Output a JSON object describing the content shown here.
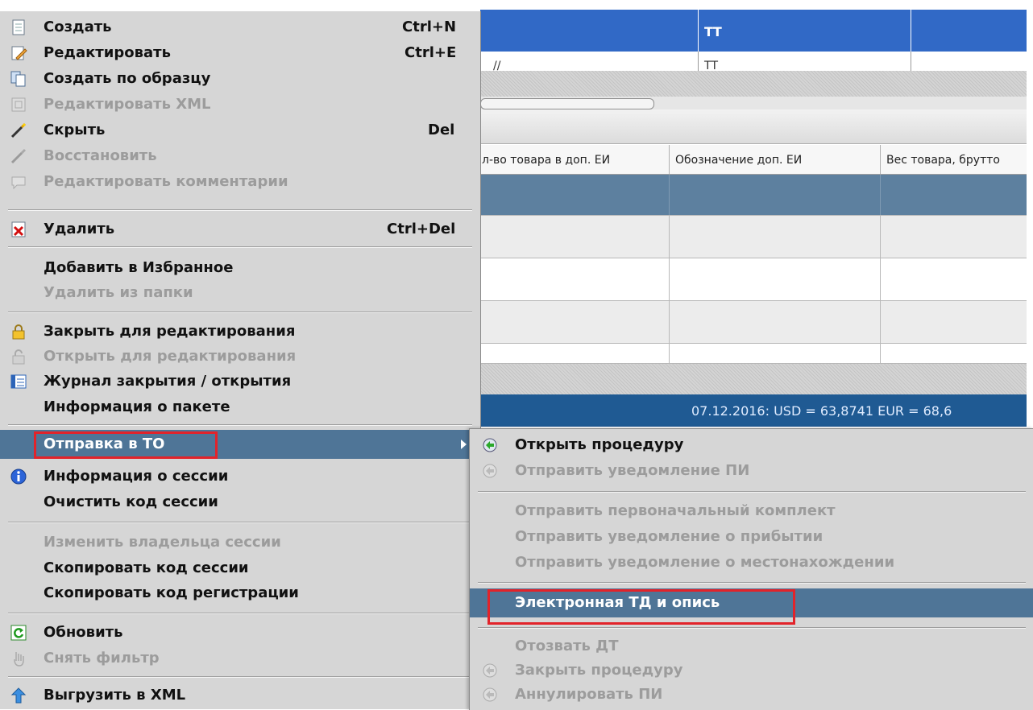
{
  "background": {
    "top_grid": {
      "header_col2": "ТТ",
      "row_col1": "//",
      "row_col2": "ТТ"
    },
    "grid_columns": [
      "л-во товара в доп. ЕИ",
      "Обозначение доп. ЕИ",
      "Вес товара, брутто"
    ],
    "status_bar": {
      "text": "07.12.2016:  USD = 63,8741  EUR = 68,6"
    }
  },
  "context_menu": {
    "items": [
      {
        "label": "Создать",
        "shortcut": "Ctrl+N",
        "icon": "document-new-icon",
        "enabled": true
      },
      {
        "label": "Редактировать",
        "shortcut": "Ctrl+E",
        "icon": "pencil-edit-icon",
        "enabled": true
      },
      {
        "label": "Создать по образцу",
        "shortcut": "",
        "icon": "copy-document-icon",
        "enabled": true
      },
      {
        "label": "Редактировать XML",
        "shortcut": "",
        "icon": "xml-edit-icon",
        "enabled": false
      },
      {
        "label": "Скрыть",
        "shortcut": "Del",
        "icon": "wand-hide-icon",
        "enabled": true
      },
      {
        "label": "Восстановить",
        "shortcut": "",
        "icon": "restore-icon",
        "enabled": false
      },
      {
        "label": "Редактировать комментарии",
        "shortcut": "",
        "icon": "comment-icon",
        "enabled": false
      },
      {
        "label": "Удалить",
        "shortcut": "Ctrl+Del",
        "icon": "delete-x-icon",
        "enabled": true
      },
      {
        "label": "Добавить в Избранное",
        "shortcut": "",
        "icon": "",
        "enabled": true
      },
      {
        "label": "Удалить из папки",
        "shortcut": "",
        "icon": "",
        "enabled": false
      },
      {
        "label": "Закрыть для редактирования",
        "shortcut": "",
        "icon": "lock-icon",
        "enabled": true
      },
      {
        "label": "Открыть для редактирования",
        "shortcut": "",
        "icon": "unlock-icon",
        "enabled": false
      },
      {
        "label": "Журнал закрытия / открытия",
        "shortcut": "",
        "icon": "list-log-icon",
        "enabled": true
      },
      {
        "label": "Информация о пакете",
        "shortcut": "",
        "icon": "",
        "enabled": true
      },
      {
        "label": "Отправка в ТО",
        "shortcut": "",
        "icon": "",
        "enabled": true
      },
      {
        "label": "Информация о сессии",
        "shortcut": "",
        "icon": "info-icon",
        "enabled": true
      },
      {
        "label": "Очистить код сессии",
        "shortcut": "",
        "icon": "",
        "enabled": true
      },
      {
        "label": "Изменить владельца сессии",
        "shortcut": "",
        "icon": "",
        "enabled": false
      },
      {
        "label": "Скопировать код сессии",
        "shortcut": "",
        "icon": "",
        "enabled": true
      },
      {
        "label": "Скопировать код регистрации",
        "shortcut": "",
        "icon": "",
        "enabled": true
      },
      {
        "label": "Обновить",
        "shortcut": "",
        "icon": "refresh-icon",
        "enabled": true
      },
      {
        "label": "Снять фильтр",
        "shortcut": "",
        "icon": "filter-clear-icon",
        "enabled": false
      },
      {
        "label": "Выгрузить в XML",
        "shortcut": "",
        "icon": "export-xml-icon",
        "enabled": true
      }
    ]
  },
  "submenu": {
    "items": [
      {
        "label": "Открыть процедуру",
        "icon": "procedure-open-icon",
        "enabled": true
      },
      {
        "label": "Отправить уведомление ПИ",
        "icon": "procedure-notify-icon",
        "enabled": false
      },
      {
        "label": "Отправить первоначальный комплект",
        "icon": "",
        "enabled": false
      },
      {
        "label": "Отправить уведомление о прибытии",
        "icon": "",
        "enabled": false
      },
      {
        "label": "Отправить уведомление о местонахождении",
        "icon": "",
        "enabled": false
      },
      {
        "label": "Электронная ТД и опись",
        "icon": "",
        "enabled": true
      },
      {
        "label": "Отозвать ДТ",
        "icon": "",
        "enabled": false
      },
      {
        "label": "Закрыть процедуру",
        "icon": "procedure-close-icon",
        "enabled": false
      },
      {
        "label": "Аннулировать ПИ",
        "icon": "procedure-cancel-icon",
        "enabled": false
      }
    ]
  },
  "colors": {
    "highlight": "#4f7597",
    "menu_bg": "#d6d6d6",
    "annotation_red": "#e2232a",
    "disabled_text": "#9c9c9c"
  }
}
